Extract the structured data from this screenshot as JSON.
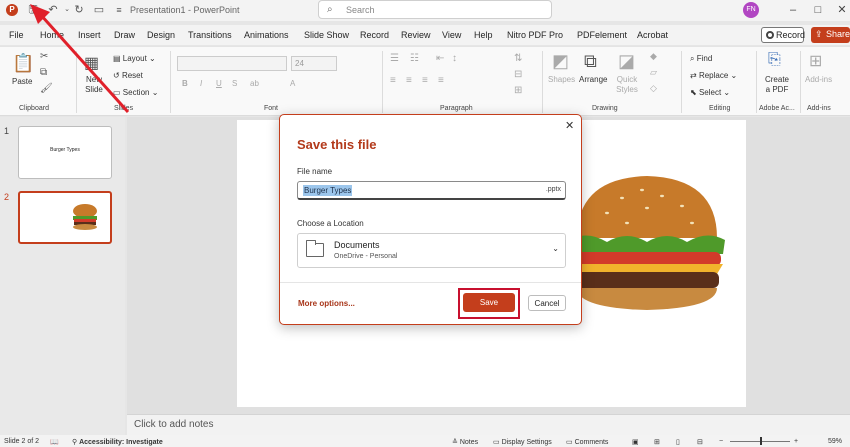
{
  "app": {
    "window_title": "Presentation1 - PowerPoint",
    "search_placeholder": "Search",
    "user_initials": "FN"
  },
  "icons": {
    "app": "powerpoint-icon",
    "save": "save-icon",
    "undo": "undo-icon",
    "redo": "redo-icon",
    "present": "present-icon",
    "customize": "customize-qat-icon",
    "search": "search-icon",
    "minimize": "minimize-icon",
    "maximize": "maximize-icon",
    "close": "close-icon"
  },
  "tabs": [
    "File",
    "Home",
    "Insert",
    "Draw",
    "Design",
    "Transitions",
    "Animations",
    "Slide Show",
    "Record",
    "Review",
    "View",
    "Help",
    "Nitro PDF Pro",
    "PDFelement",
    "Acrobat"
  ],
  "record_label": "Record",
  "share_label": "Share",
  "ribbon": {
    "paste": "Paste",
    "clipboard": "Clipboard",
    "new_slide": "New Slide",
    "layout": "Layout",
    "reset": "Reset",
    "section": "Section",
    "slides": "Slides",
    "font_size": "24",
    "font": "Font",
    "paragraph": "Paragraph",
    "shapes": "Shapes",
    "arrange": "Arrange",
    "quick_styles": "Quick Styles",
    "drawing": "Drawing",
    "find": "Find",
    "replace": "Replace",
    "select": "Select",
    "editing": "Editing",
    "create_pdf": "Create a PDF",
    "adobe": "Adobe Ac...",
    "addins": "Add-ins",
    "addins_group": "Add-ins",
    "font_buttons": [
      "B",
      "I",
      "U",
      "S",
      "ab",
      "A"
    ]
  },
  "slides": [
    {
      "number": "1",
      "title": "Burger Types"
    },
    {
      "number": "2"
    }
  ],
  "notes_placeholder": "Click to add notes",
  "dialog": {
    "title": "Save this file",
    "file_name_label": "File name",
    "file_name_value": "Burger Types",
    "extension": ".pptx",
    "location_label": "Choose a Location",
    "location_name": "Documents",
    "location_sub": "OneDrive - Personal",
    "more_options": "More options...",
    "save": "Save",
    "cancel": "Cancel"
  },
  "status": {
    "slide_of": "Slide 2 of 2",
    "accessibility": "Accessibility: Investigate",
    "notes": "Notes",
    "display_settings": "Display Settings",
    "comments": "Comments",
    "zoom": "59%"
  },
  "colors": {
    "accent": "#c43e1c",
    "highlight": "#c8102e",
    "arrow": "#e0202a"
  }
}
